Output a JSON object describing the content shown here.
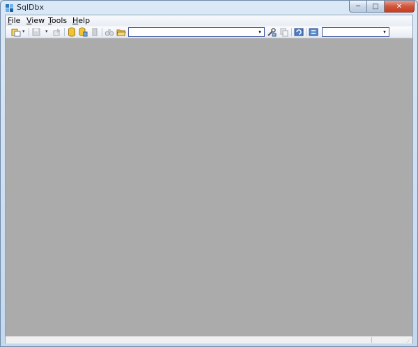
{
  "window": {
    "title": "SqlDbx",
    "caption": {
      "minimize": "─",
      "maximize": "□",
      "close": "✕"
    }
  },
  "menu": [
    {
      "id": "file",
      "mnemonic": "F",
      "rest": "ile"
    },
    {
      "id": "view",
      "mnemonic": "V",
      "rest": "iew"
    },
    {
      "id": "tools",
      "mnemonic": "T",
      "rest": "ools"
    },
    {
      "id": "help",
      "mnemonic": "H",
      "rest": "elp"
    }
  ],
  "toolbar": {
    "object_combo": {
      "value": ""
    },
    "database_combo": {
      "value": ""
    },
    "dropdown_glyph": "▾"
  },
  "statusbar": {
    "text": ""
  },
  "colors": {
    "workspace": "#ababab",
    "combo_border": "#4a5fa8",
    "close_button": "#c43e22"
  }
}
